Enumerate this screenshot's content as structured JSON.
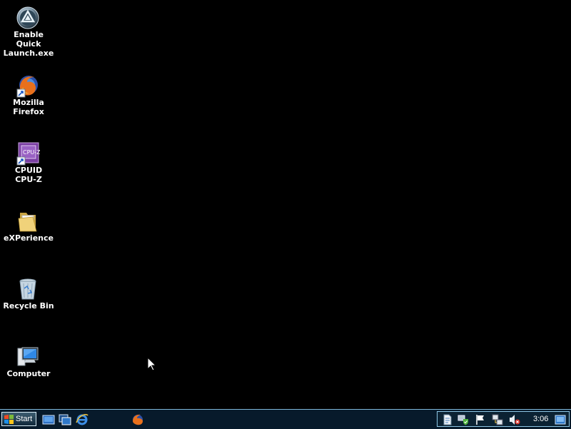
{
  "desktop": {
    "icons": [
      {
        "name": "aim-quicklaunch",
        "label": "Enable Quick\nLaunch.exe"
      },
      {
        "name": "firefox",
        "label": "Mozilla\nFirefox"
      },
      {
        "name": "cpuz",
        "label": "CPUID\nCPU-Z"
      },
      {
        "name": "folder",
        "label": "eXPerience"
      },
      {
        "name": "recycle-bin",
        "label": "Recycle Bin"
      },
      {
        "name": "computer",
        "label": "Computer"
      }
    ]
  },
  "taskbar": {
    "start_label": "Start",
    "quick_launch": [
      "show-desktop-icon",
      "switch-windows-icon",
      "internet-explorer-icon",
      "firefox-icon"
    ],
    "tray": {
      "icons": [
        "document-icon",
        "network-shield-icon",
        "flag-icon",
        "network-icon",
        "volume-muted-icon"
      ],
      "clock": "3:06"
    }
  },
  "colors": {
    "desktop_bg": "#000000",
    "taskbar_bg": "#071a2b",
    "taskbar_border": "#7fb6d9"
  }
}
